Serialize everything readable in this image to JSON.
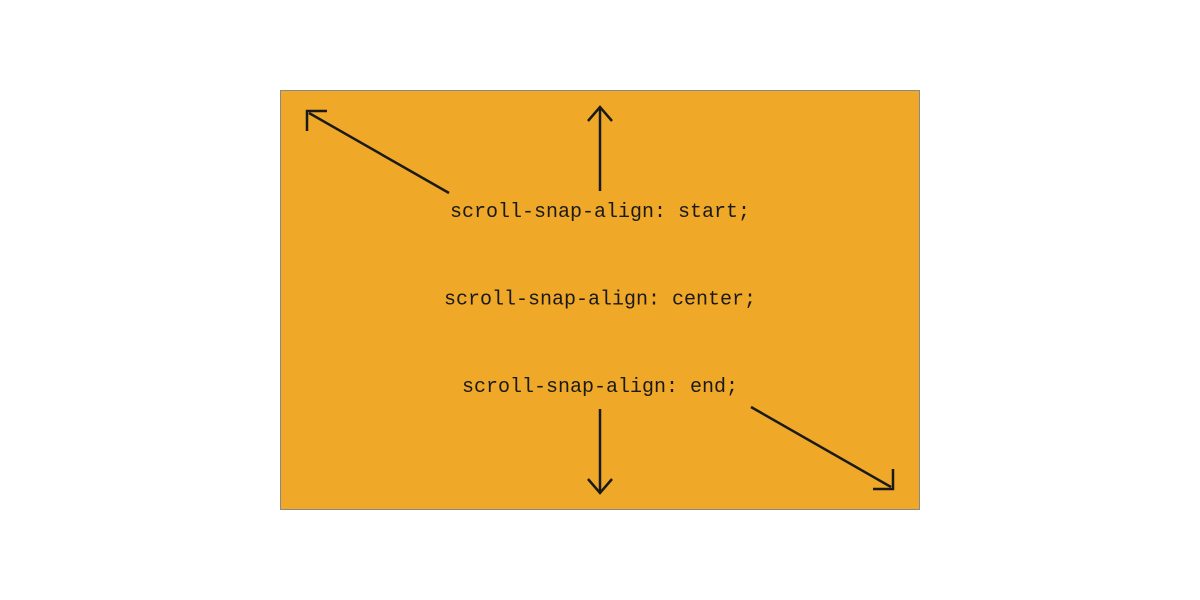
{
  "diagram": {
    "labels": {
      "start": "scroll-snap-align: start;",
      "center": "scroll-snap-align: center;",
      "end": "scroll-snap-align: end;"
    },
    "colors": {
      "box_fill": "#f0a829",
      "box_border": "#888888",
      "arrow_stroke": "#1a1a1a",
      "text": "#1a1a1a"
    }
  }
}
